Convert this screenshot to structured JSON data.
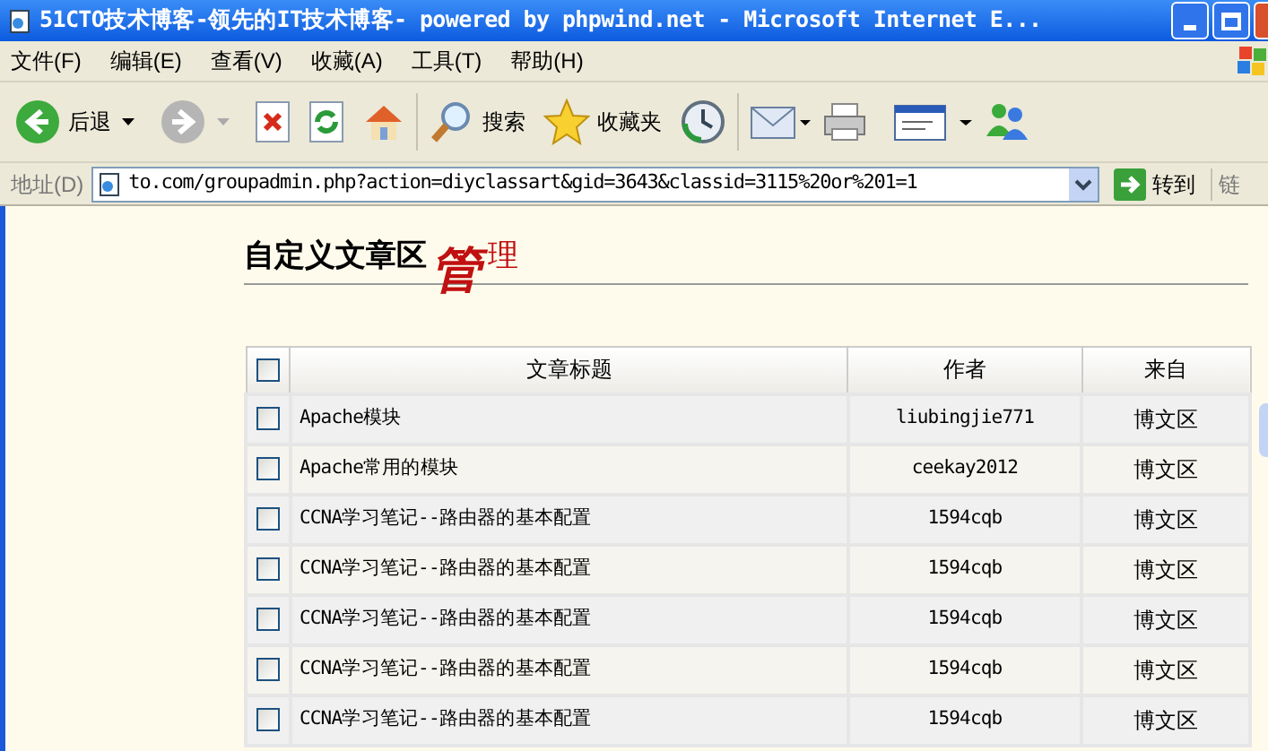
{
  "window": {
    "title": "51CTO技术博客-领先的IT技术博客- powered by phpwind.net - Microsoft Internet E..."
  },
  "menu": [
    "文件(F)",
    "编辑(E)",
    "查看(V)",
    "收藏(A)",
    "工具(T)",
    "帮助(H)"
  ],
  "toolbar": {
    "back": "后退",
    "search": "搜索",
    "favorites": "收藏夹"
  },
  "address_bar": {
    "label": "地址(D)",
    "value": "to.com/groupadmin.php?action=diyclassart&gid=3643&classid=3115%20or%201=1",
    "go": "转到",
    "links": "链"
  },
  "page": {
    "heading": "自定义文章区",
    "heading_accent_1": "管",
    "heading_accent_2": "理",
    "table": {
      "select_all": {
        "checked": false
      },
      "columns": [
        "文章标题",
        "作者",
        "来自"
      ],
      "rows": [
        {
          "checked": false,
          "title": "Apache模块",
          "author": "liubingjie771",
          "source": "博文区"
        },
        {
          "checked": false,
          "title": "Apache常用的模块",
          "author": "ceekay2012",
          "source": "博文区"
        },
        {
          "checked": false,
          "title": "CCNA学习笔记--路由器的基本配置",
          "author": "1594cqb",
          "source": "博文区"
        },
        {
          "checked": false,
          "title": "CCNA学习笔记--路由器的基本配置",
          "author": "1594cqb",
          "source": "博文区"
        },
        {
          "checked": false,
          "title": "CCNA学习笔记--路由器的基本配置",
          "author": "1594cqb",
          "source": "博文区"
        },
        {
          "checked": false,
          "title": "CCNA学习笔记--路由器的基本配置",
          "author": "1594cqb",
          "source": "博文区"
        },
        {
          "checked": false,
          "title": "CCNA学习笔记--路由器的基本配置",
          "author": "1594cqb",
          "source": "博文区"
        }
      ]
    }
  }
}
